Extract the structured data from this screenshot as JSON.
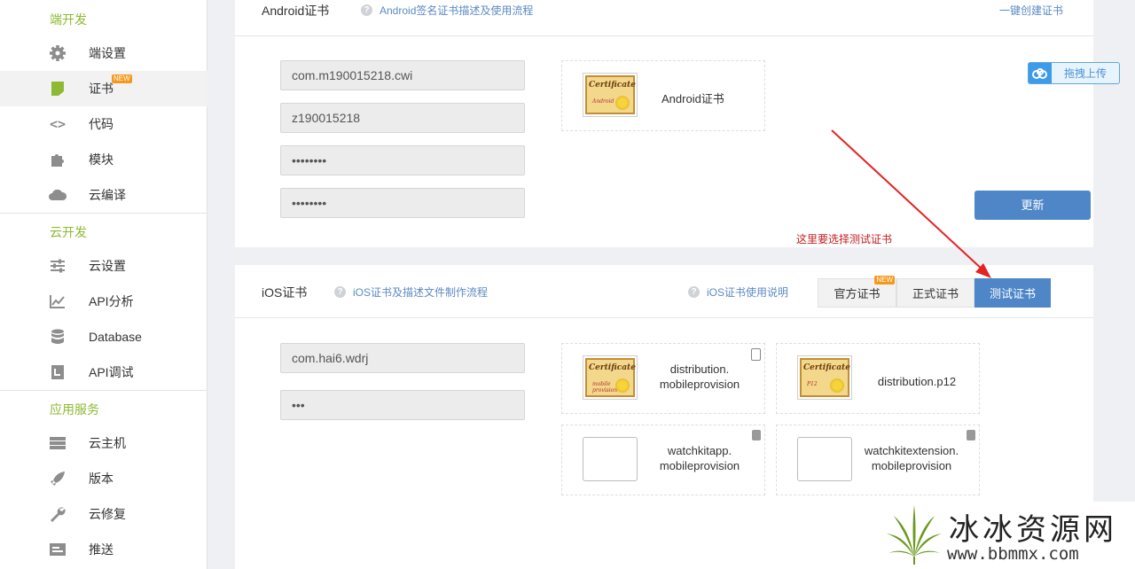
{
  "sidebar": {
    "sections": [
      {
        "title": "端开发",
        "items": [
          {
            "label": "端设置",
            "icon": "gear-icon"
          },
          {
            "label": "证书",
            "icon": "certificate-icon",
            "badge": "NEW",
            "active": true
          },
          {
            "label": "代码",
            "icon": "code-icon"
          },
          {
            "label": "模块",
            "icon": "puzzle-icon"
          },
          {
            "label": "云编译",
            "icon": "cloud-icon"
          }
        ]
      },
      {
        "title": "云开发",
        "items": [
          {
            "label": "云设置",
            "icon": "sliders-icon"
          },
          {
            "label": "API分析",
            "icon": "chart-line-icon"
          },
          {
            "label": "Database",
            "icon": "database-icon"
          },
          {
            "label": "API调试",
            "icon": "debug-icon"
          }
        ]
      },
      {
        "title": "应用服务",
        "items": [
          {
            "label": "云主机",
            "icon": "server-icon"
          },
          {
            "label": "版本",
            "icon": "rocket-icon"
          },
          {
            "label": "云修复",
            "icon": "wrench-icon"
          },
          {
            "label": "推送",
            "icon": "push-icon"
          }
        ]
      }
    ]
  },
  "android": {
    "title": "Android证书",
    "help": "Android签名证书描述及使用流程",
    "quick_create": "一键创建证书",
    "fields": [
      "com.m190015218.cwi",
      "z190015218",
      "••••••••",
      "••••••••"
    ],
    "cert_name": "Android证书",
    "cert_image_text": "Certificate",
    "cert_image_sub": "Android",
    "update_label": "更新",
    "upload_label": "拖拽上传"
  },
  "annotation": "这里要选择测试证书",
  "ios": {
    "title": "iOS证书",
    "help": "iOS证书及描述文件制作流程",
    "usage": "iOS证书使用说明",
    "tabs": [
      {
        "label": "官方证书",
        "badge": "NEW"
      },
      {
        "label": "正式证书"
      },
      {
        "label": "测试证书",
        "active": true
      }
    ],
    "fields": [
      "com.hai6.wdrj",
      "•••"
    ],
    "files": [
      {
        "line1": "distribution.",
        "line2": "mobileprovision",
        "img_sub": "mobile provision"
      },
      {
        "line1": "distribution.p12",
        "line2": "",
        "img_sub": "P12"
      },
      {
        "line1": "watchkitapp.",
        "line2": "mobileprovision"
      },
      {
        "line1": "watchkitextension.",
        "line2": "mobileprovision"
      }
    ]
  },
  "watermark": {
    "text": "冰冰资源网",
    "url": "www.bbmmx.com"
  },
  "colors": {
    "accent": "#4e86c8",
    "section_green": "#8cba32",
    "badge_orange": "#f7981c",
    "annotation_red": "#c02020"
  }
}
